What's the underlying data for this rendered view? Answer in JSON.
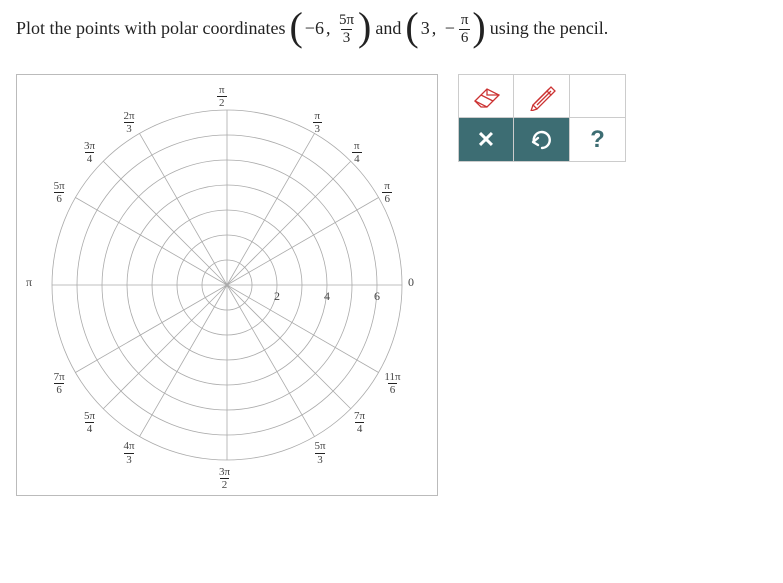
{
  "question": {
    "prefix": "Plot the points with polar coordinates",
    "between": "and",
    "suffix": "using the pencil.",
    "point1": {
      "r": "−6",
      "theta_num": "5π",
      "theta_den": "3"
    },
    "point2": {
      "r": "3",
      "theta_sign": "−",
      "theta_num": "π",
      "theta_den": "6"
    }
  },
  "chart_data": {
    "type": "polar-grid",
    "r_ticks": [
      2,
      4,
      6
    ],
    "r_max": 7,
    "angle_labels": [
      {
        "label": "0",
        "angle_deg": 0,
        "frac": null
      },
      {
        "label": "π/6",
        "angle_deg": 30,
        "frac": {
          "n": "π",
          "d": "6"
        }
      },
      {
        "label": "π/4",
        "angle_deg": 45,
        "frac": {
          "n": "π",
          "d": "4"
        }
      },
      {
        "label": "π/3",
        "angle_deg": 60,
        "frac": {
          "n": "π",
          "d": "3"
        }
      },
      {
        "label": "π/2",
        "angle_deg": 90,
        "frac": {
          "n": "π",
          "d": "2"
        }
      },
      {
        "label": "2π/3",
        "angle_deg": 120,
        "frac": {
          "n": "2π",
          "d": "3"
        }
      },
      {
        "label": "3π/4",
        "angle_deg": 135,
        "frac": {
          "n": "3π",
          "d": "4"
        }
      },
      {
        "label": "5π/6",
        "angle_deg": 150,
        "frac": {
          "n": "5π",
          "d": "6"
        }
      },
      {
        "label": "π",
        "angle_deg": 180,
        "frac": null
      },
      {
        "label": "7π/6",
        "angle_deg": 210,
        "frac": {
          "n": "7π",
          "d": "6"
        }
      },
      {
        "label": "5π/4",
        "angle_deg": 225,
        "frac": {
          "n": "5π",
          "d": "4"
        }
      },
      {
        "label": "4π/3",
        "angle_deg": 240,
        "frac": {
          "n": "4π",
          "d": "3"
        }
      },
      {
        "label": "3π/2",
        "angle_deg": 270,
        "frac": {
          "n": "3π",
          "d": "2"
        }
      },
      {
        "label": "5π/3",
        "angle_deg": 300,
        "frac": {
          "n": "5π",
          "d": "3"
        }
      },
      {
        "label": "7π/4",
        "angle_deg": 315,
        "frac": {
          "n": "7π",
          "d": "4"
        }
      },
      {
        "label": "11π/6",
        "angle_deg": 330,
        "frac": {
          "n": "11π",
          "d": "6"
        }
      }
    ]
  },
  "tools": {
    "eraser": "eraser",
    "pencil": "pencil",
    "blank": "",
    "close": "✕",
    "undo": "undo",
    "help": "?"
  }
}
